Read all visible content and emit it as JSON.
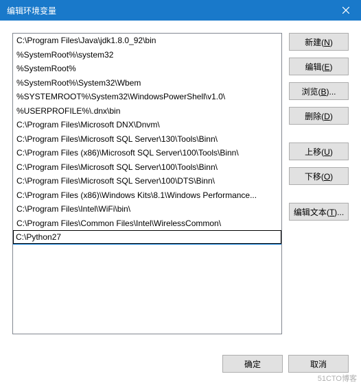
{
  "titlebar": {
    "title": "编辑环境变量"
  },
  "list": {
    "items": [
      "C:\\Program Files\\Java\\jdk1.8.0_92\\bin",
      "%SystemRoot%\\system32",
      "%SystemRoot%",
      "%SystemRoot%\\System32\\Wbem",
      "%SYSTEMROOT%\\System32\\WindowsPowerShell\\v1.0\\",
      "%USERPROFILE%\\.dnx\\bin",
      "C:\\Program Files\\Microsoft DNX\\Dnvm\\",
      "C:\\Program Files\\Microsoft SQL Server\\130\\Tools\\Binn\\",
      "C:\\Program Files (x86)\\Microsoft SQL Server\\100\\Tools\\Binn\\",
      "C:\\Program Files\\Microsoft SQL Server\\100\\Tools\\Binn\\",
      "C:\\Program Files\\Microsoft SQL Server\\100\\DTS\\Binn\\",
      "C:\\Program Files (x86)\\Windows Kits\\8.1\\Windows Performance...",
      "C:\\Program Files\\Intel\\WiFi\\bin\\",
      "C:\\Program Files\\Common Files\\Intel\\WirelessCommon\\"
    ],
    "editing_value": "C:\\Python27"
  },
  "buttons": {
    "new": {
      "text": "新建(",
      "mnemonic": "N",
      "suffix": ")"
    },
    "edit": {
      "text": "编辑(",
      "mnemonic": "E",
      "suffix": ")"
    },
    "browse": {
      "text": "浏览(",
      "mnemonic": "B",
      "suffix": ")..."
    },
    "delete": {
      "text": "删除(",
      "mnemonic": "D",
      "suffix": ")"
    },
    "moveup": {
      "text": "上移(",
      "mnemonic": "U",
      "suffix": ")"
    },
    "movedown": {
      "text": "下移(",
      "mnemonic": "O",
      "suffix": ")"
    },
    "edittext": {
      "text": "编辑文本(",
      "mnemonic": "T",
      "suffix": ")..."
    }
  },
  "footer": {
    "ok": "确定",
    "cancel": "取消"
  },
  "watermark": "51CTO博客"
}
